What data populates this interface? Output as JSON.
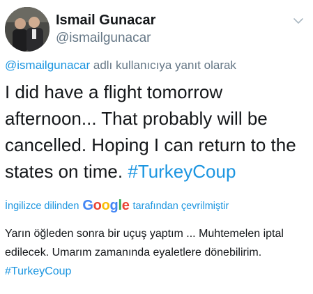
{
  "user": {
    "name": "Ismail Gunacar",
    "handle": "@ismailgunacar"
  },
  "reply_context": {
    "mention": "@ismailgunacar",
    "suffix": "adlı kullanıcıya yanıt olarak"
  },
  "tweet": {
    "text": "I did have a flight tomorrow afternoon... That probably will be cancelled. Hoping I can return to the states on time.",
    "hashtag": "#TurkeyCoup"
  },
  "translation": {
    "prefix": "İngilizce dilinden",
    "suffix": "tarafından çevrilmiştir",
    "logo_text": "Google",
    "text": "Yarın öğleden sonra bir uçuş yaptım ... Muhtemelen iptal edilecek. Umarım zamanında eyaletlere dönebilirim.",
    "hashtag": "#TurkeyCoup"
  },
  "colors": {
    "link": "#1b95e0",
    "secondary_text": "#657786",
    "primary_text": "#14171a"
  },
  "icons": {
    "menu": "chevron-down-icon"
  }
}
